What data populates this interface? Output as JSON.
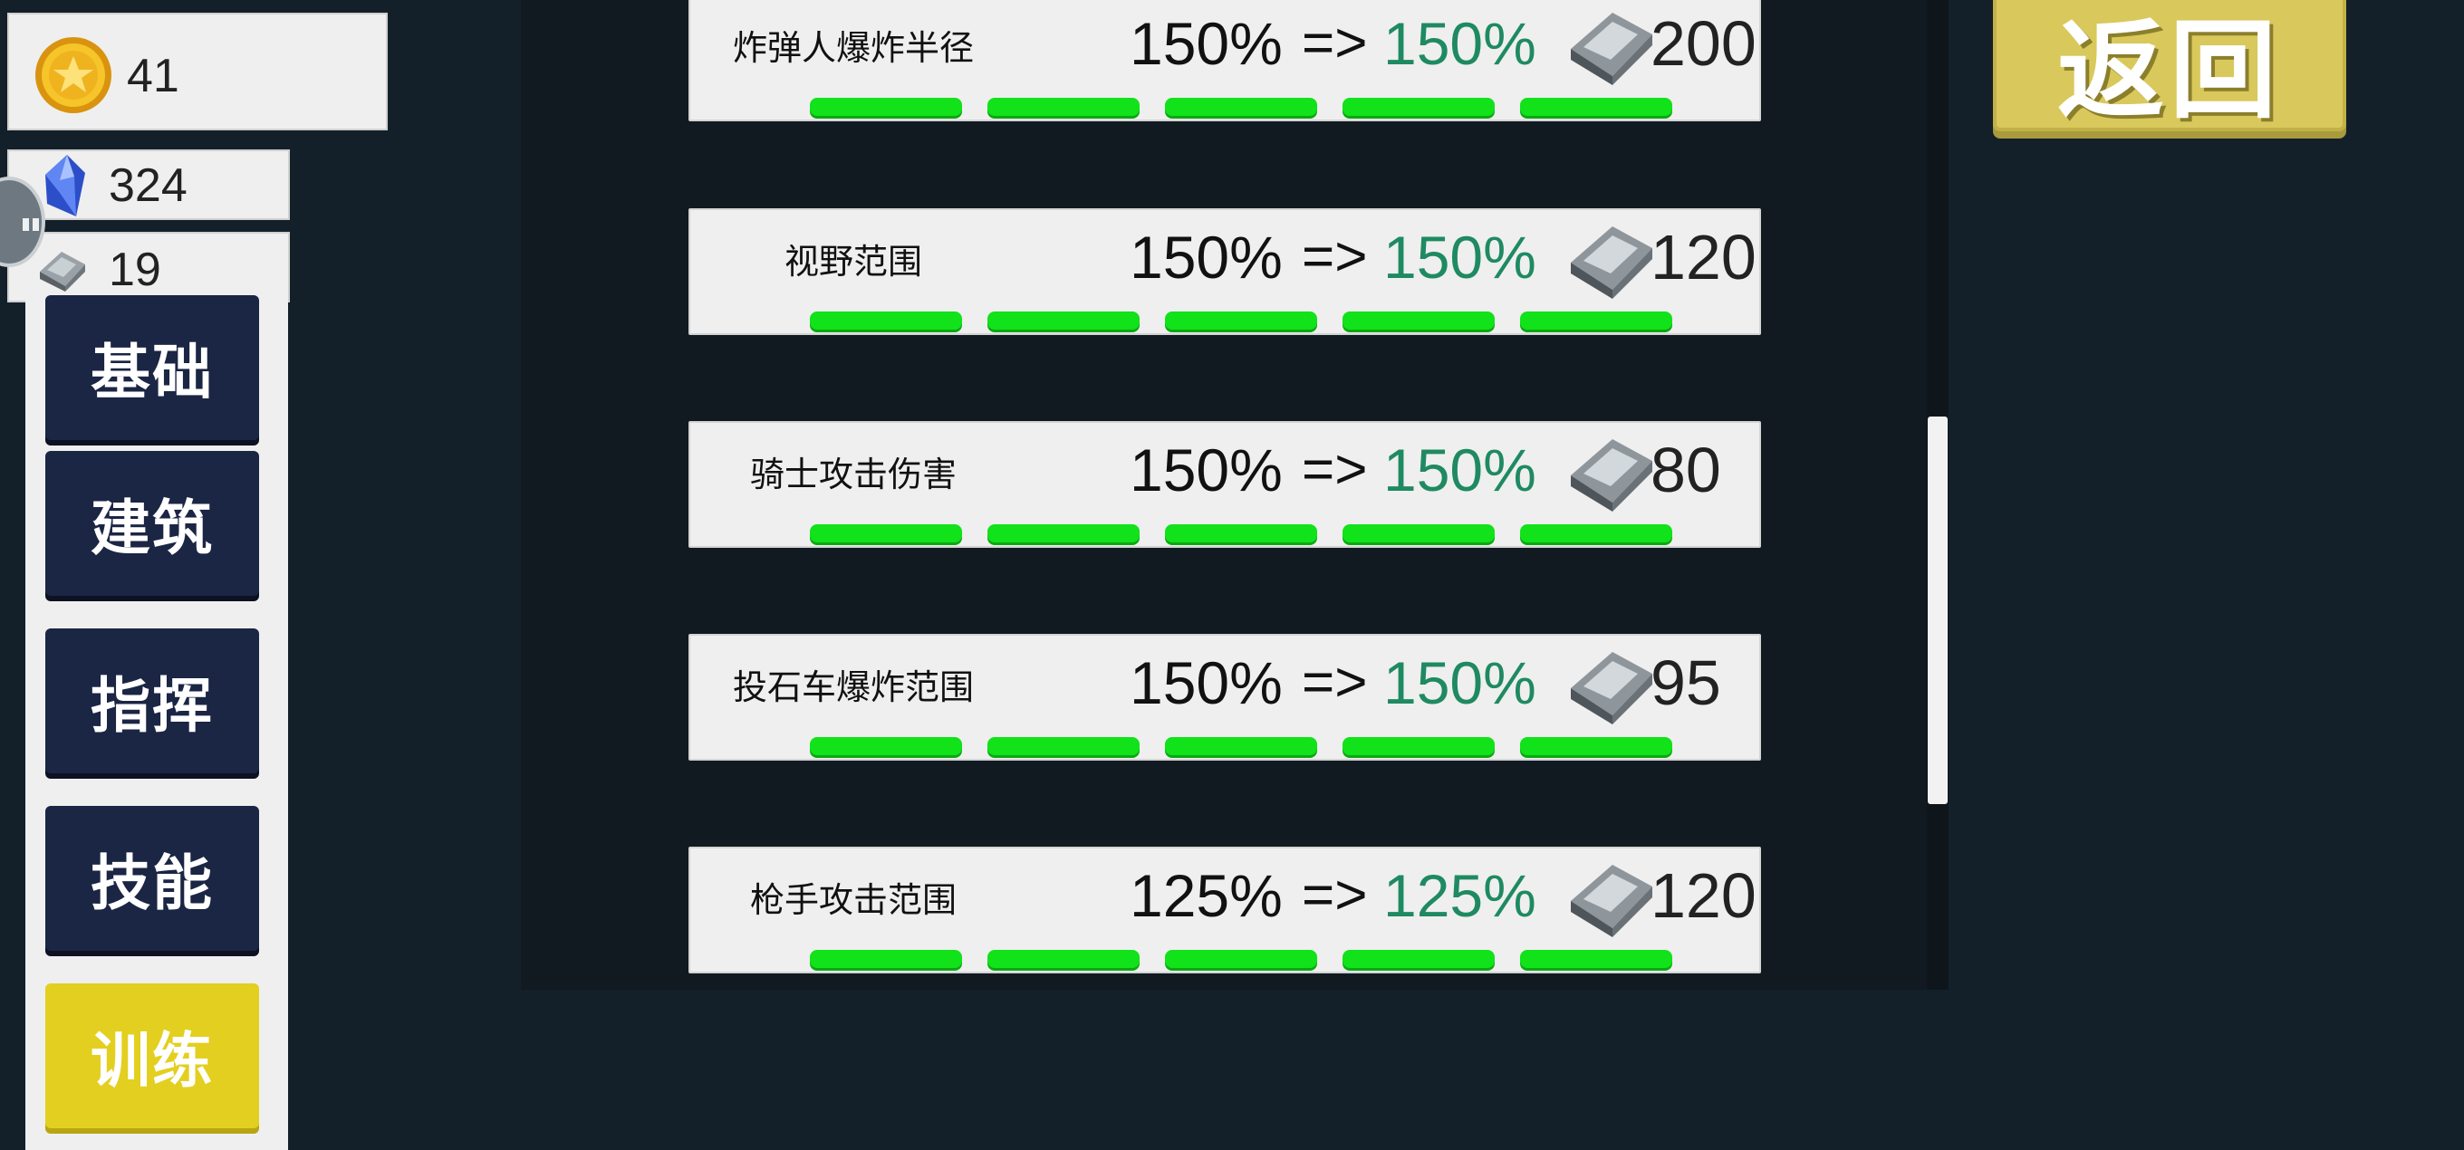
{
  "resources": {
    "gold": "41",
    "gem": "324",
    "iron": "19"
  },
  "categories": [
    {
      "label": "基础",
      "active": false
    },
    {
      "label": "建筑",
      "active": false
    },
    {
      "label": "指挥",
      "active": false
    },
    {
      "label": "技能",
      "active": false
    },
    {
      "label": "训练",
      "active": true
    }
  ],
  "upgrades": [
    {
      "name": "炸弹人爆炸半径",
      "current": "150%",
      "arrow": "=>",
      "next": "150%",
      "cost": "200",
      "level": 5
    },
    {
      "name": "视野范围",
      "current": "150%",
      "arrow": "=>",
      "next": "150%",
      "cost": "120",
      "level": 5
    },
    {
      "name": "骑士攻击伤害",
      "current": "150%",
      "arrow": "=>",
      "next": "150%",
      "cost": "80",
      "level": 5
    },
    {
      "name": "投石车爆炸范围",
      "current": "150%",
      "arrow": "=>",
      "next": "150%",
      "cost": "95",
      "level": 5
    },
    {
      "name": "枪手攻击范围",
      "current": "125%",
      "arrow": "=>",
      "next": "125%",
      "cost": "120",
      "level": 5
    }
  ],
  "back_button": "返回",
  "colors": {
    "next_value": "#1f8a62",
    "level_bar": "#11e21a",
    "active_tab": "#e3cf1f",
    "tab": "#1b2544"
  }
}
